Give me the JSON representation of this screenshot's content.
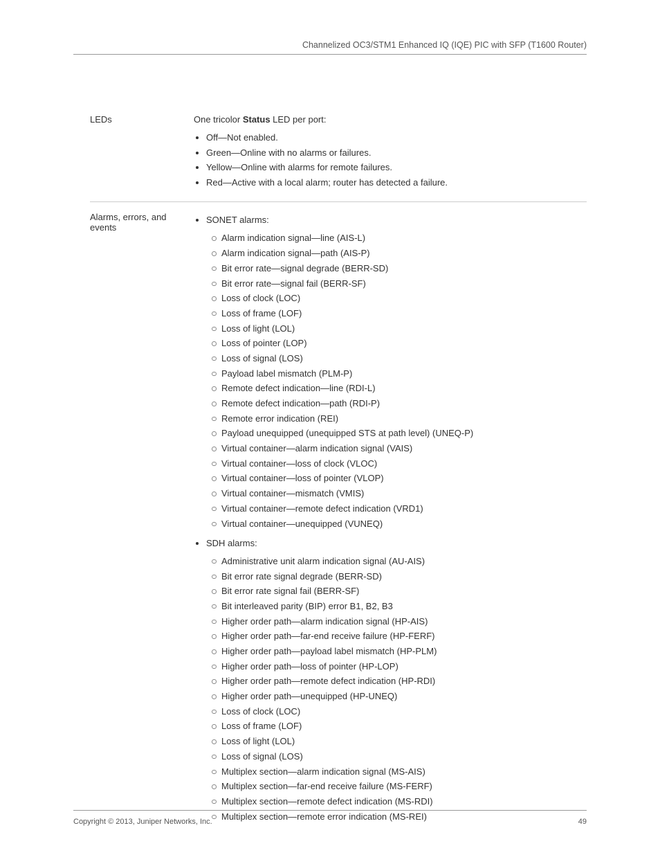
{
  "header": "Channelized OC3/STM1 Enhanced IQ (IQE) PIC with SFP (T1600 Router)",
  "footer": {
    "left": "Copyright © 2013, Juniper Networks, Inc.",
    "right": "49"
  },
  "rows": [
    {
      "label": "LEDs",
      "intro_pre": "One tricolor ",
      "intro_bold": "Status",
      "intro_post": " LED per port:",
      "bullets": [
        "Off—Not enabled.",
        "Green—Online with no alarms or failures.",
        "Yellow—Online with alarms for remote failures.",
        "Red—Active with a local alarm; router has detected a failure."
      ]
    },
    {
      "label": "Alarms, errors, and events",
      "groups": [
        {
          "title": "SONET alarms:",
          "items": [
            "Alarm indication signal—line (AIS-L)",
            "Alarm indication signal—path (AIS-P)",
            "Bit error rate—signal degrade (BERR-SD)",
            "Bit error rate—signal fail (BERR-SF)",
            "Loss of clock (LOC)",
            "Loss of frame (LOF)",
            "Loss of light (LOL)",
            "Loss of pointer (LOP)",
            "Loss of signal (LOS)",
            "Payload label mismatch (PLM-P)",
            "Remote defect indication—line (RDI-L)",
            "Remote defect indication—path (RDI-P)",
            "Remote error indication (REI)",
            "Payload unequipped (unequipped STS at path level) (UNEQ-P)",
            "Virtual container—alarm indication signal (VAIS)",
            "Virtual container—loss of clock (VLOC)",
            "Virtual container—loss of pointer (VLOP)",
            "Virtual container—mismatch (VMIS)",
            "Virtual container—remote defect indication (VRD1)",
            "Virtual container—unequipped (VUNEQ)"
          ]
        },
        {
          "title": "SDH alarms:",
          "items": [
            "Administrative unit alarm indication signal (AU-AIS)",
            "Bit error rate signal degrade (BERR-SD)",
            "Bit error rate signal fail (BERR-SF)",
            "Bit interleaved parity (BIP) error B1, B2, B3",
            "Higher order path—alarm indication signal (HP-AIS)",
            "Higher order path—far-end receive failure (HP-FERF)",
            "Higher order path—payload label mismatch (HP-PLM)",
            "Higher order path—loss of pointer (HP-LOP)",
            "Higher order path—remote defect indication (HP-RDI)",
            "Higher order path—unequipped (HP-UNEQ)",
            "Loss of clock (LOC)",
            "Loss of frame (LOF)",
            "Loss of light (LOL)",
            "Loss of signal (LOS)",
            "Multiplex section—alarm indication signal (MS-AIS)",
            "Multiplex section—far-end receive failure (MS-FERF)",
            "Multiplex section—remote defect indication (MS-RDI)",
            "Multiplex section—remote error indication (MS-REI)"
          ]
        }
      ]
    }
  ]
}
